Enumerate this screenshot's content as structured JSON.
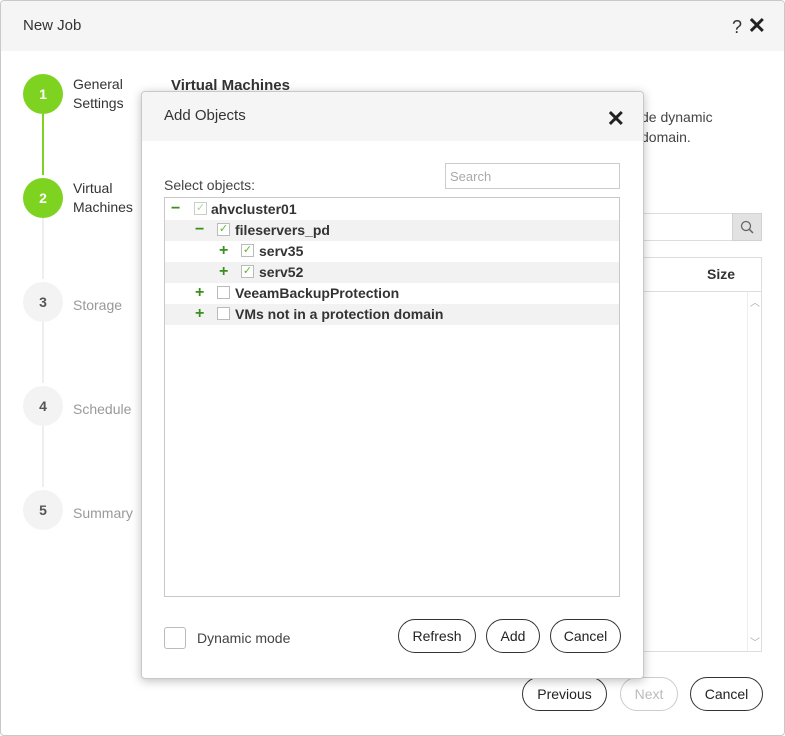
{
  "window": {
    "title": "New Job",
    "help_glyph": "?",
    "close_glyph": "✕"
  },
  "steps": [
    {
      "number": "1",
      "label": "General Settings",
      "state": "done"
    },
    {
      "number": "2",
      "label": "Virtual Machines",
      "state": "active"
    },
    {
      "number": "3",
      "label": "Storage",
      "state": "pending"
    },
    {
      "number": "4",
      "label": "Schedule",
      "state": "pending"
    },
    {
      "number": "5",
      "label": "Summary",
      "state": "pending"
    }
  ],
  "background": {
    "title": "Virtual Machines",
    "desc_line1": "de dynamic",
    "desc_line2": "domain.",
    "table_size_header": "Size"
  },
  "footer": {
    "previous": "Previous",
    "next": "Next",
    "cancel": "Cancel"
  },
  "dialog": {
    "title": "Add Objects",
    "close_glyph": "✕",
    "search_placeholder": "Search",
    "select_label": "Select objects:",
    "tree": [
      {
        "label": "ahvcluster01",
        "expander": "−",
        "checked": "partial"
      },
      {
        "label": "fileservers_pd",
        "expander": "−",
        "checked": true
      },
      {
        "label": "serv35",
        "expander": "+",
        "checked": true
      },
      {
        "label": "serv52",
        "expander": "+",
        "checked": true
      },
      {
        "label": "VeeamBackupProtection",
        "expander": "+",
        "checked": false
      },
      {
        "label": "VMs not in a protection domain",
        "expander": "+",
        "checked": false
      }
    ],
    "dynamic_mode_label": "Dynamic mode",
    "dynamic_mode_checked": false,
    "buttons": {
      "refresh": "Refresh",
      "add": "Add",
      "cancel": "Cancel"
    }
  },
  "colors": {
    "accent": "#7dd320",
    "expander": "#3a8f1e",
    "check": "#5cb82a"
  }
}
